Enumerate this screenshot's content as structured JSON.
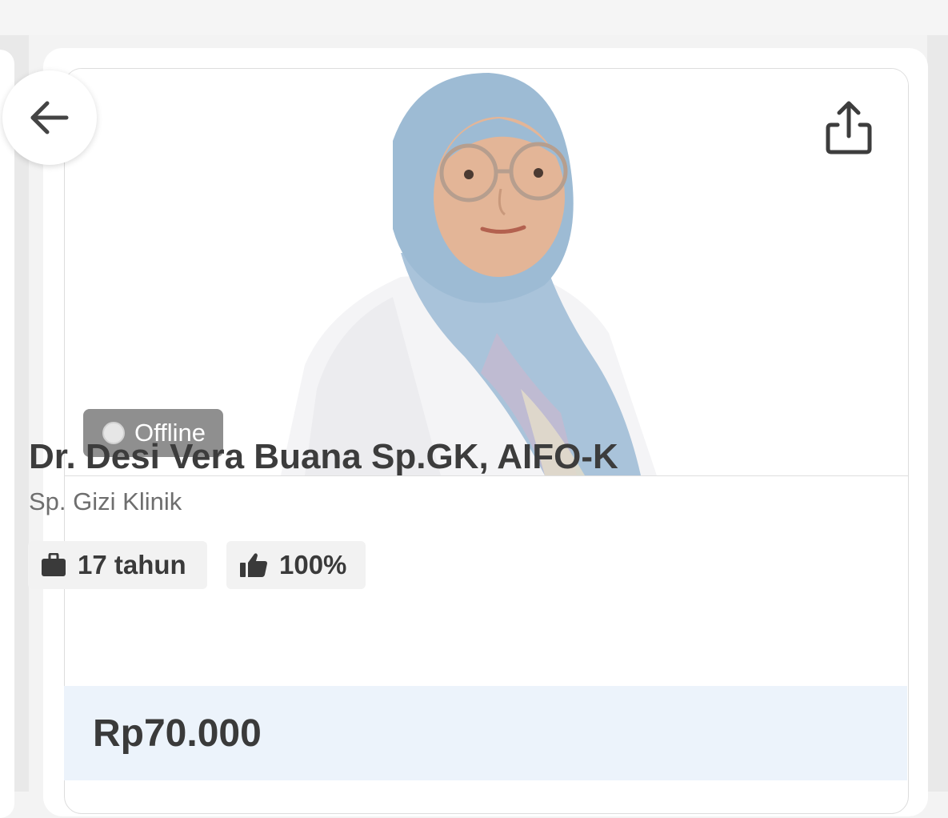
{
  "doctor": {
    "name": "Dr. Desi Vera Buana Sp.GK, AIFO-K",
    "specialty": "Sp. Gizi Klinik",
    "status": "Offline",
    "experience": "17 tahun",
    "rating": "100%",
    "price": "Rp70.000"
  },
  "icons": {
    "back": "arrow-left-icon",
    "share": "share-icon",
    "experience": "briefcase-icon",
    "rating": "thumbs-up-icon",
    "status": "status-dot-icon"
  },
  "colors": {
    "status_badge": "#8f8f8f",
    "price_band": "#ecf3fb",
    "text_dark": "#3c3c3c",
    "text_muted": "#6e6e6e"
  }
}
